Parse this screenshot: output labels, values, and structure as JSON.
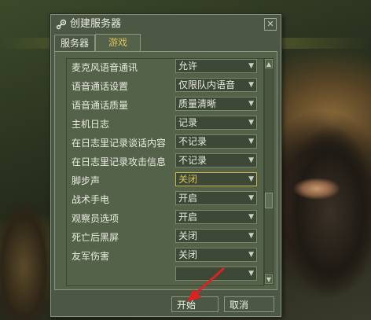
{
  "window": {
    "title": "创建服务器",
    "close_glyph": "✕"
  },
  "tabs": [
    {
      "label": "服务器",
      "active": false
    },
    {
      "label": "游戏",
      "active": true
    }
  ],
  "settings": [
    {
      "label": "麦克风语音通讯",
      "value": "允许"
    },
    {
      "label": "语音通话设置",
      "value": "仅限队内语音"
    },
    {
      "label": "语音通话质量",
      "value": "质量清晰"
    },
    {
      "label": "主机日志",
      "value": "记录"
    },
    {
      "label": "在日志里记录谈话内容",
      "value": "不记录"
    },
    {
      "label": "在日志里记录攻击信息",
      "value": "不记录"
    },
    {
      "label": "脚步声",
      "value": "关闭",
      "highlighted": true
    },
    {
      "label": "战术手电",
      "value": "开启"
    },
    {
      "label": "观察员选项",
      "value": "开启"
    },
    {
      "label": "死亡后黑屏",
      "value": "关闭"
    },
    {
      "label": "友军伤害",
      "value": "关闭"
    }
  ],
  "footer": {
    "start_label": "开始",
    "cancel_label": "取消"
  },
  "colors": {
    "window_bg": "#4c5844",
    "panel_bg": "#55624a",
    "active_tab_text": "#d9c25a",
    "annotation_arrow": "#e02020"
  },
  "icons": {
    "title_icon": "steam-icon",
    "dropdown": "chevron-down-icon",
    "scroll_up": "scroll-up-arrow-icon",
    "scroll_down": "scroll-down-arrow-icon"
  }
}
